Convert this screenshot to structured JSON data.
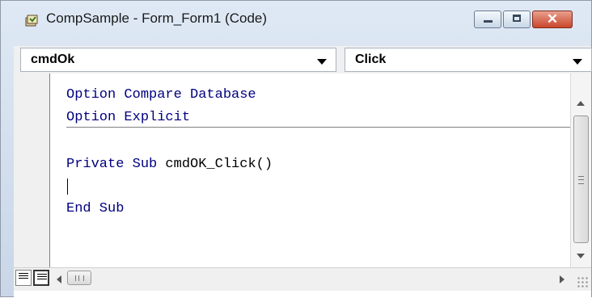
{
  "window": {
    "title": "CompSample - Form_Form1 (Code)",
    "icon": "vba-code-window-icon",
    "controls": {
      "minimize": "minimize-icon",
      "maximize": "maximize-icon",
      "close": "close-icon",
      "close_glyph": "✕"
    }
  },
  "object_combo": {
    "value": "cmdOk"
  },
  "procedure_combo": {
    "value": "Click"
  },
  "code": {
    "line1": "Option Compare Database",
    "line2": "Option Explicit",
    "line3_keyword": "Private Sub ",
    "line3_name": "cmdOK_Click()",
    "line4": "End Sub"
  },
  "colors": {
    "keyword": "#000080",
    "title_bar": "#c8d6e8",
    "close_button": "#c9462b"
  }
}
